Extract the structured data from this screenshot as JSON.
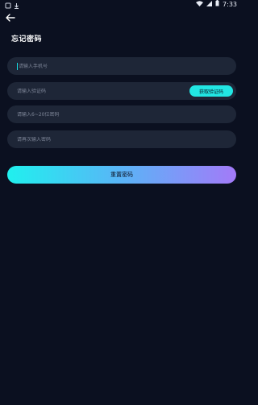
{
  "status_bar": {
    "time": "7:33"
  },
  "header": {
    "title": "忘记密码"
  },
  "form": {
    "phone_placeholder": "请输入手机号",
    "code_placeholder": "请输入验证码",
    "get_code_label": "获取验证码",
    "password_placeholder": "请输入6~20位密码",
    "confirm_placeholder": "请再次输入密码",
    "submit_label": "重置密码"
  },
  "colors": {
    "background": "#0b1020",
    "field_bg": "#1e2637",
    "accent": "#22e6e3",
    "gradient_end": "#a37af8"
  },
  "icons": {
    "back": "arrow-left-icon",
    "wifi": "wifi-icon",
    "signal": "signal-icon",
    "battery": "battery-icon"
  }
}
